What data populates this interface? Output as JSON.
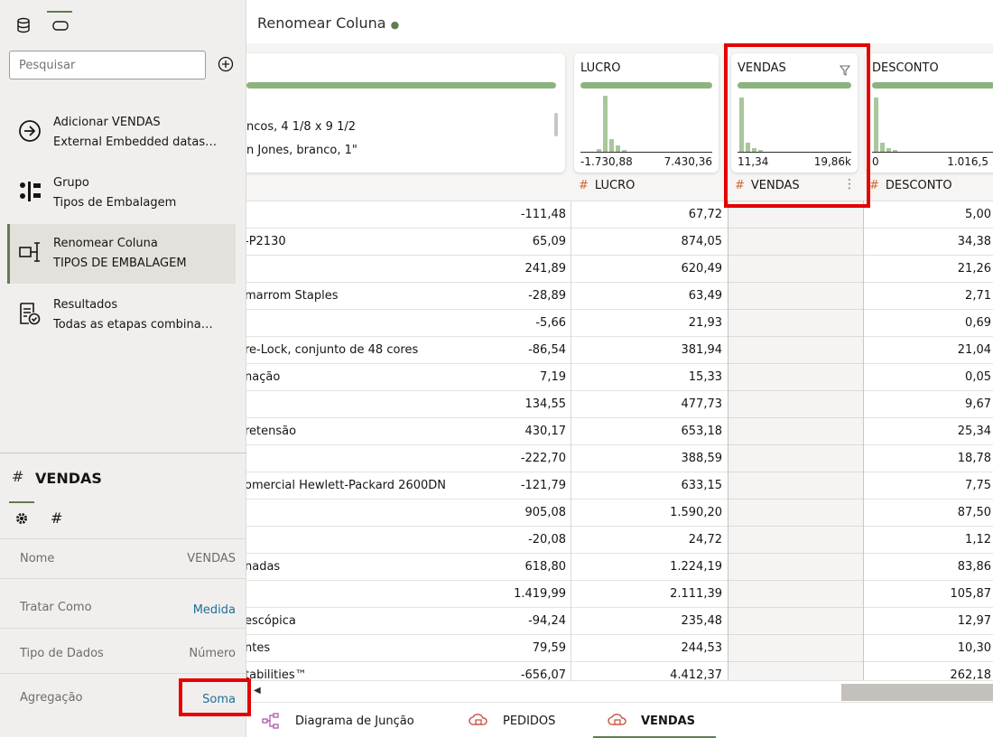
{
  "left_panel": {
    "search_placeholder": "Pesquisar",
    "steps": [
      {
        "title": "Adicionar VENDAS",
        "subtitle": "External Embedded datas…",
        "icon": "arrow-circle-icon"
      },
      {
        "title": "Grupo",
        "subtitle": "Tipos de Embalagem",
        "icon": "group-icon"
      },
      {
        "title": "Renomear Coluna",
        "subtitle": "TIPOS DE EMBALAGEM",
        "icon": "rename-column-icon"
      },
      {
        "title": "Resultados",
        "subtitle": "Todas as etapas combina…",
        "icon": "results-icon"
      }
    ],
    "properties": {
      "hash": "#",
      "column_name": "VENDAS",
      "tab_hash": "#",
      "rows": [
        {
          "label": "Nome",
          "value": "VENDAS"
        },
        {
          "label": "Tratar Como",
          "value": "Medida"
        },
        {
          "label": "Tipo de Dados",
          "value": "Número"
        },
        {
          "label": "Agregação",
          "value": "Soma"
        }
      ]
    }
  },
  "main": {
    "title": "Renomear Coluna",
    "first_card_lines": [
      "ncos, 4 1/8 x 9 1/2",
      "n Jones, branco, 1\""
    ],
    "cards": [
      {
        "name": "LUCRO",
        "min": "-1.730,88",
        "max": "7.430,36"
      },
      {
        "name": "VENDAS",
        "min": "11,34",
        "max": "19,86k"
      },
      {
        "name": "DESCONTO",
        "min": "0",
        "max": "1.016,5"
      }
    ],
    "headers": [
      "LUCRO",
      "VENDAS",
      "DESCONTO"
    ],
    "hash": "#",
    "rows": [
      [
        "",
        "-111,48",
        "67,72",
        "5,00"
      ],
      [
        "-P2130",
        "65,09",
        "874,05",
        "34,38"
      ],
      [
        "",
        "241,89",
        "620,49",
        "21,26"
      ],
      [
        "marrom Staples",
        "-28,89",
        "63,49",
        "2,71"
      ],
      [
        "",
        "-5,66",
        "21,93",
        "0,69"
      ],
      [
        "re-Lock, conjunto de 48 cores",
        "-86,54",
        "381,94",
        "21,04"
      ],
      [
        "nação",
        "7,19",
        "15,33",
        "0,05"
      ],
      [
        "",
        "134,55",
        "477,73",
        "9,67"
      ],
      [
        "retensão",
        "430,17",
        "653,18",
        "25,34"
      ],
      [
        "",
        "-222,70",
        "388,59",
        "18,78"
      ],
      [
        "omercial Hewlett-Packard 2600DN",
        "-121,79",
        "633,15",
        "7,75"
      ],
      [
        "",
        "905,08",
        "1.590,20",
        "87,50"
      ],
      [
        "",
        "-20,08",
        "24,72",
        "1,12"
      ],
      [
        "nadas",
        "618,80",
        "1.224,19",
        "83,86"
      ],
      [
        "",
        "1.419,99",
        "2.111,39",
        "105,87"
      ],
      [
        "escópica",
        "-94,24",
        "235,48",
        "12,97"
      ],
      [
        "ntes",
        "79,59",
        "244,53",
        "10,30"
      ],
      [
        "tabilities™",
        "-656,07",
        "4.412,37",
        "262,18"
      ]
    ],
    "tabs": [
      {
        "label": "Diagrama de Junção",
        "icon": "join-diagram-icon"
      },
      {
        "label": "PEDIDOS",
        "icon": "cloud-dataset-icon"
      },
      {
        "label": "VENDAS",
        "icon": "cloud-dataset-icon"
      }
    ]
  },
  "colors": {
    "accent": "#5f7d4f",
    "highlight": "#e50000",
    "link": "#1d6f97"
  }
}
